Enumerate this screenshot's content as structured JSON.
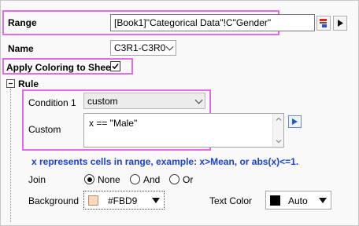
{
  "range": {
    "label": "Range",
    "value": "[Book1]\"Categorical Data\"!C\"Gender\""
  },
  "name": {
    "label": "Name",
    "value": "C3R1-C3R0"
  },
  "apply": {
    "label": "Apply Coloring to Sheet",
    "checked": true
  },
  "rule": {
    "label": "Rule",
    "condition_label": "Condition 1",
    "condition_value": "custom",
    "custom_label": "Custom",
    "custom_value": "x == \"Male\"",
    "hint": "x represents cells in range, example: x>Mean, or abs(x)<=1."
  },
  "join": {
    "label": "Join",
    "options": [
      "None",
      "And",
      "Or"
    ],
    "selected": "None"
  },
  "background": {
    "label": "Background",
    "value": "#FBD9",
    "swatch": "#FBD9B8"
  },
  "text_color": {
    "label": "Text Color",
    "value": "Auto",
    "swatch": "#000000"
  },
  "colors": {
    "highlight": "#e36be8",
    "hint": "#1a3fd6",
    "accent": "#1560bd"
  }
}
